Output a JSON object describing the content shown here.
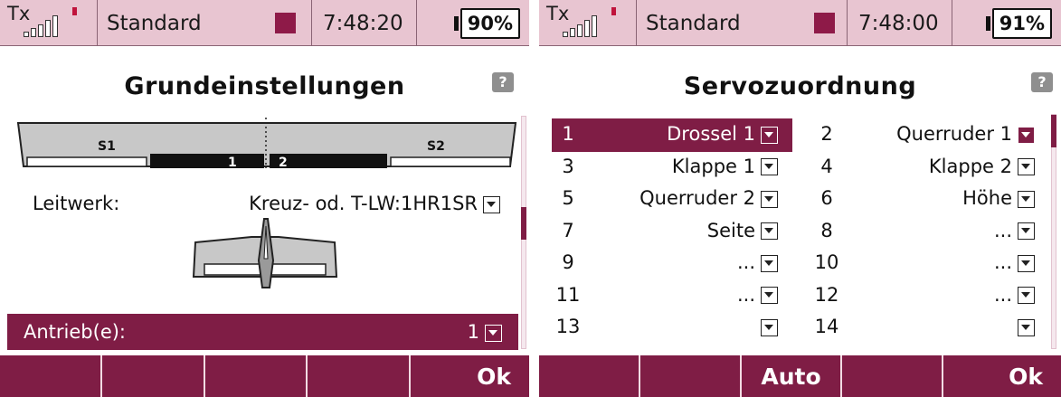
{
  "left": {
    "status": {
      "tx_label": "Tx",
      "model_name": "Standard",
      "time": "7:48:20",
      "battery": "90%"
    },
    "help_label": "?",
    "title": "Grundeinstellungen",
    "wing": {
      "servo1_label": "S1",
      "servo2_label": "S2",
      "flap1_label": "1",
      "flap2_label": "2"
    },
    "leitwerk": {
      "label": "Leitwerk:",
      "value": "Kreuz- od. T-LW:1HR1SR"
    },
    "antrieb": {
      "label": "Antrieb(e):",
      "value": "1"
    },
    "softkeys": [
      "",
      "",
      "",
      "",
      "Ok"
    ],
    "scroll_position": 0.45
  },
  "right": {
    "status": {
      "tx_label": "Tx",
      "model_name": "Standard",
      "time": "7:48:00",
      "battery": "91%"
    },
    "help_label": "?",
    "title": "Servozuordnung",
    "rows": [
      {
        "n1": "1",
        "v1": "Drossel 1",
        "n2": "2",
        "v2": "Querruder 1",
        "selected": true
      },
      {
        "n1": "3",
        "v1": "Klappe 1",
        "n2": "4",
        "v2": "Klappe 2",
        "selected": false
      },
      {
        "n1": "5",
        "v1": "Querruder 2",
        "n2": "6",
        "v2": "Höhe",
        "selected": false
      },
      {
        "n1": "7",
        "v1": "Seite",
        "n2": "8",
        "v2": "...",
        "selected": false
      },
      {
        "n1": "9",
        "v1": "...",
        "n2": "10",
        "v2": "...",
        "selected": false
      },
      {
        "n1": "11",
        "v1": "...",
        "n2": "12",
        "v2": "...",
        "selected": false
      },
      {
        "n1": "13",
        "v1": "",
        "n2": "14",
        "v2": "",
        "selected": false
      }
    ],
    "softkeys": [
      "",
      "",
      "Auto",
      "",
      "Ok"
    ],
    "scroll_position": 0.0
  },
  "colors": {
    "status_bg": "#e8c5d1",
    "accent": "#7f1d45",
    "signal_red": "#c0143c"
  },
  "icons": [
    "signal-strength-icon",
    "help-icon",
    "dropdown-arrow-icon",
    "battery-icon",
    "model-color-square-icon"
  ]
}
